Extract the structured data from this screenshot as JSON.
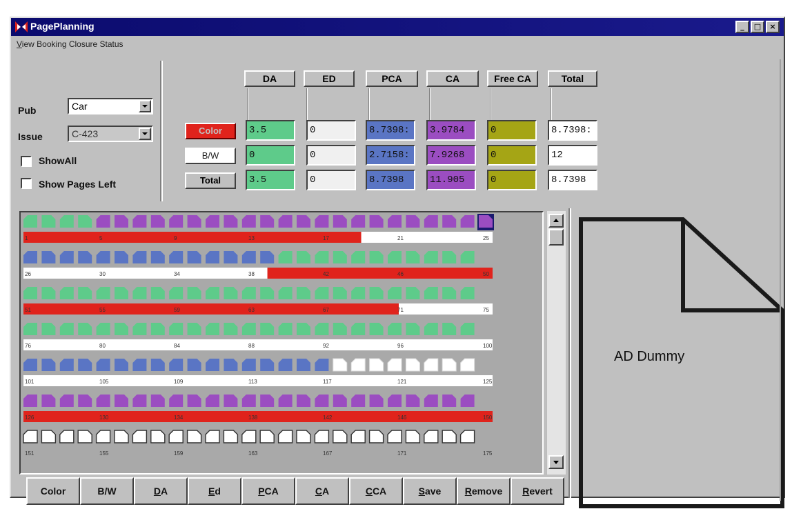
{
  "window": {
    "title": "PagePlanning"
  },
  "menu": {
    "item_first": "V",
    "item_rest": "iew Booking Closure Status"
  },
  "filters": {
    "pub_label": "Pub",
    "pub_value": "Car",
    "issue_label": "Issue",
    "issue_value": "C-423",
    "show_all_label": "ShowAll",
    "show_pages_left_label": "Show Pages Left"
  },
  "summary": {
    "columns": [
      "DA",
      "ED",
      "PCA",
      "CA",
      "Free CA",
      "Total"
    ],
    "rows": [
      {
        "label": "Color",
        "values": [
          "3.5",
          "0",
          "8.7398:",
          "3.9784",
          "0",
          "8.7398:"
        ]
      },
      {
        "label": "B/W",
        "values": [
          "0",
          "0",
          "2.7158:",
          "7.9268",
          "0",
          "12"
        ]
      },
      {
        "label": "Total",
        "values": [
          "3.5",
          "0",
          "8.7398",
          "11.905",
          "0",
          "8.7398"
        ]
      }
    ]
  },
  "colors": {
    "da": "#5ecb8a",
    "ed": "#f0f0f0",
    "pca": "#5a75c4",
    "ca": "#9b4dc1",
    "free_ca": "#a5a515",
    "color_bar": "#e0231c",
    "bw_bar": "#ffffff",
    "empty_page": "#ffffff"
  },
  "page_grid": {
    "rows": [
      {
        "pages": [
          "g",
          "g",
          "g",
          "g",
          "p",
          "p",
          "p",
          "p",
          "p",
          "p",
          "p",
          "p",
          "p",
          "p",
          "p",
          "p",
          "p",
          "p",
          "p",
          "p",
          "p",
          "p",
          "p",
          "p",
          "p",
          "sel"
        ],
        "numbers": [
          "1",
          "5",
          "9",
          "13",
          "17",
          "21",
          "25"
        ],
        "bar": [
          [
            "r",
            0.0,
            0.72
          ],
          [
            "w",
            0.72,
            1.0
          ]
        ]
      },
      {
        "pages": [
          "b",
          "b",
          "b",
          "b",
          "b",
          "b",
          "b",
          "b",
          "b",
          "b",
          "b",
          "b",
          "b",
          "b",
          "g",
          "g",
          "g",
          "g",
          "g",
          "g",
          "g",
          "g",
          "g",
          "g",
          "g"
        ],
        "numbers": [
          "26",
          "30",
          "34",
          "38",
          "42",
          "46",
          "50"
        ],
        "bar": [
          [
            "w",
            0.0,
            0.52
          ],
          [
            "r",
            0.52,
            1.0
          ]
        ]
      },
      {
        "pages": [
          "g",
          "g",
          "g",
          "g",
          "g",
          "g",
          "g",
          "g",
          "g",
          "g",
          "g",
          "g",
          "g",
          "g",
          "g",
          "g",
          "g",
          "g",
          "g",
          "g",
          "g",
          "g",
          "g",
          "g",
          "g"
        ],
        "numbers": [
          "51",
          "55",
          "59",
          "63",
          "67",
          "71",
          "75"
        ],
        "bar": [
          [
            "r",
            0.0,
            0.8
          ],
          [
            "w",
            0.8,
            1.0
          ]
        ]
      },
      {
        "pages": [
          "g",
          "g",
          "g",
          "g",
          "g",
          "g",
          "g",
          "g",
          "g",
          "g",
          "g",
          "g",
          "g",
          "g",
          "g",
          "g",
          "g",
          "g",
          "g",
          "g",
          "g",
          "g",
          "g",
          "g",
          "g"
        ],
        "numbers": [
          "76",
          "80",
          "84",
          "88",
          "92",
          "96",
          "100"
        ],
        "bar": [
          [
            "w",
            0.0,
            1.0
          ]
        ]
      },
      {
        "pages": [
          "b",
          "b",
          "b",
          "b",
          "b",
          "b",
          "b",
          "b",
          "b",
          "b",
          "b",
          "b",
          "b",
          "b",
          "b",
          "b",
          "b",
          "w",
          "w",
          "w",
          "w",
          "w",
          "w",
          "w",
          "w"
        ],
        "numbers": [
          "101",
          "105",
          "109",
          "113",
          "117",
          "121",
          "125"
        ],
        "bar": [
          [
            "w",
            0.0,
            1.0
          ]
        ]
      },
      {
        "pages": [
          "p",
          "p",
          "p",
          "p",
          "p",
          "p",
          "p",
          "p",
          "p",
          "p",
          "p",
          "p",
          "p",
          "p",
          "p",
          "p",
          "p",
          "p",
          "p",
          "p",
          "p",
          "p",
          "p",
          "p",
          "p"
        ],
        "numbers": [
          "126",
          "130",
          "134",
          "138",
          "142",
          "146",
          "150"
        ],
        "bar": [
          [
            "r",
            0.0,
            1.0
          ]
        ]
      },
      {
        "pages": [
          "o",
          "o",
          "o",
          "o",
          "o",
          "o",
          "o",
          "o",
          "o",
          "o",
          "o",
          "o",
          "o",
          "o",
          "o",
          "o",
          "o",
          "o",
          "o",
          "o",
          "o",
          "o",
          "o",
          "o",
          "o"
        ],
        "numbers": [
          "151",
          "155",
          "159",
          "163",
          "167",
          "171",
          "175"
        ],
        "bar": []
      }
    ]
  },
  "dummy": {
    "label": "AD Dummy"
  },
  "toolbar": [
    {
      "name": "color-button",
      "u": "",
      "rest": "Color"
    },
    {
      "name": "bw-button",
      "u": "",
      "rest": "B/W"
    },
    {
      "name": "da-button",
      "u": "D",
      "rest": "A"
    },
    {
      "name": "ed-button",
      "u": "E",
      "rest": "d"
    },
    {
      "name": "pca-button",
      "u": "P",
      "rest": "CA"
    },
    {
      "name": "ca-button",
      "u": "C",
      "rest": "A"
    },
    {
      "name": "cca-button",
      "u": "C",
      "rest": "CA"
    },
    {
      "name": "save-button",
      "u": "S",
      "rest": "ave"
    },
    {
      "name": "remove-button",
      "u": "R",
      "rest": "emove"
    },
    {
      "name": "revert-button",
      "u": "R",
      "rest": "evert"
    }
  ]
}
